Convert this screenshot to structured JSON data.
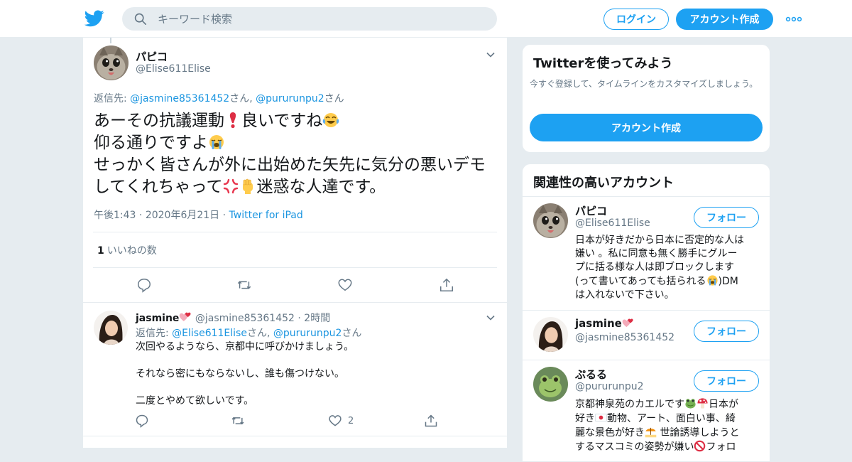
{
  "header": {
    "search_placeholder": "キーワード検索",
    "login_label": "ログイン",
    "signup_label": "アカウント作成",
    "brand_color": "#1da1f2"
  },
  "tweet": {
    "name": "パピコ",
    "handle": "@Elise611Elise",
    "reply_prefix": "返信先: ",
    "reply_to_1": "@jasmine85361452",
    "reply_sep": "さん, ",
    "reply_to_2": "@pururunpu2",
    "reply_suffix": "さん",
    "line1a": "あーその抗議運動",
    "line1b": "良いですね",
    "line2": "仰る通りですよ",
    "line3": "せっかく皆さんが外に出始めた矢先に気分の悪いデモ",
    "line4a": "してくれちゃって",
    "line4b": "迷惑な人達です。",
    "time": "午後1:43",
    "date": "2020年6月21日",
    "client": "Twitter for iPad",
    "like_count": "1",
    "like_label": "いいねの数"
  },
  "reply": {
    "name": "jasmine",
    "handle": "@jasmine85361452",
    "time": "2時間",
    "reply_prefix": "返信先: ",
    "reply_to_1": "@Elise611Elise",
    "reply_sep": "さん, ",
    "reply_to_2": "@pururunpu2",
    "reply_suffix": "さん",
    "line1": "次回やるようなら、京都中に呼びかけましょう。",
    "line2": "それなら密にもならないし、誰も傷つけない。",
    "line3": "二度とやめて欲しいです。",
    "like_count": "2"
  },
  "sidebar": {
    "signup_card": {
      "title": "Twitterを使ってみよう",
      "desc": "今すぐ登録して、タイムラインをカスタマイズしましょう。",
      "cta": "アカウント作成"
    },
    "related": {
      "title": "関連性の高いアカウント",
      "follow_label": "フォロー",
      "accounts": [
        {
          "name": "パピコ",
          "handle": "@Elise611Elise",
          "bio1": "日本が好きだから日本に否定的な人は",
          "bio2": "嫌い 。私に同意も無く勝手にグルー",
          "bio3": "プに括る様な人は即ブロックします",
          "bio4a": "(って書いてあっても括られる",
          "bio4b": ")DM",
          "bio5": "は入れないで下さい。"
        },
        {
          "name": "jasmine",
          "handle": "@jasmine85361452"
        },
        {
          "name": "ぷるる",
          "handle": "@pururunpu2",
          "bio1a": "京都神泉苑のカエルです",
          "bio1b": "日本が",
          "bio2a": "好き",
          "bio2b": "動物、アート、面白い事、綺",
          "bio3a": "麗な景色が好き",
          "bio3b": " 世論誘導しようと",
          "bio4a": "するマスコミの姿勢が嫌い",
          "bio4b": "フォロ"
        }
      ]
    }
  }
}
